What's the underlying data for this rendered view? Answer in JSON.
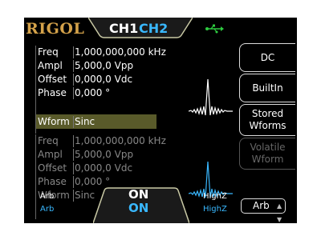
{
  "header": {
    "logo": "RIGOL",
    "ch1_tab": "CH1",
    "ch2_tab": "CH2",
    "usb_icon": "usb-icon"
  },
  "ch1_params": [
    {
      "label": "Freq",
      "value": "1,000,000,000 kHz"
    },
    {
      "label": "Ampl",
      "value": "5,000,0 Vpp"
    },
    {
      "label": "Offset",
      "value": "0,000,0 Vdc"
    },
    {
      "label": "Phase",
      "value": "0,000 °"
    },
    {
      "label": "Wform",
      "value": "Sinc"
    }
  ],
  "ch2_params": [
    {
      "label": "Freq",
      "value": "1,000,000,000 kHz"
    },
    {
      "label": "Ampl",
      "value": "5,000,0 Vpp"
    },
    {
      "label": "Offset",
      "value": "0,000,0 Vdc"
    },
    {
      "label": "Phase",
      "value": "0,000 °"
    },
    {
      "label": "Wform",
      "value": "Sinc"
    }
  ],
  "softkeys": {
    "dc": "DC",
    "builtin": "BuiltIn",
    "stored_line1": "Stored",
    "stored_line2": "Wforms",
    "volatile_line1": "Volatile",
    "volatile_line2": "Wform"
  },
  "status": {
    "ch1_mode": "Arb",
    "ch2_mode": "Arb",
    "ch1_output": "ON",
    "ch2_output": "ON",
    "ch1_load": "HighZ",
    "ch2_load": "HighZ",
    "selector": "Arb"
  },
  "colors": {
    "accent_ch1": "#ffffff",
    "accent_ch2": "#39b8ff",
    "logo": "#d4a24a",
    "usb": "#2ecc40",
    "highlight": "#595a2a"
  }
}
